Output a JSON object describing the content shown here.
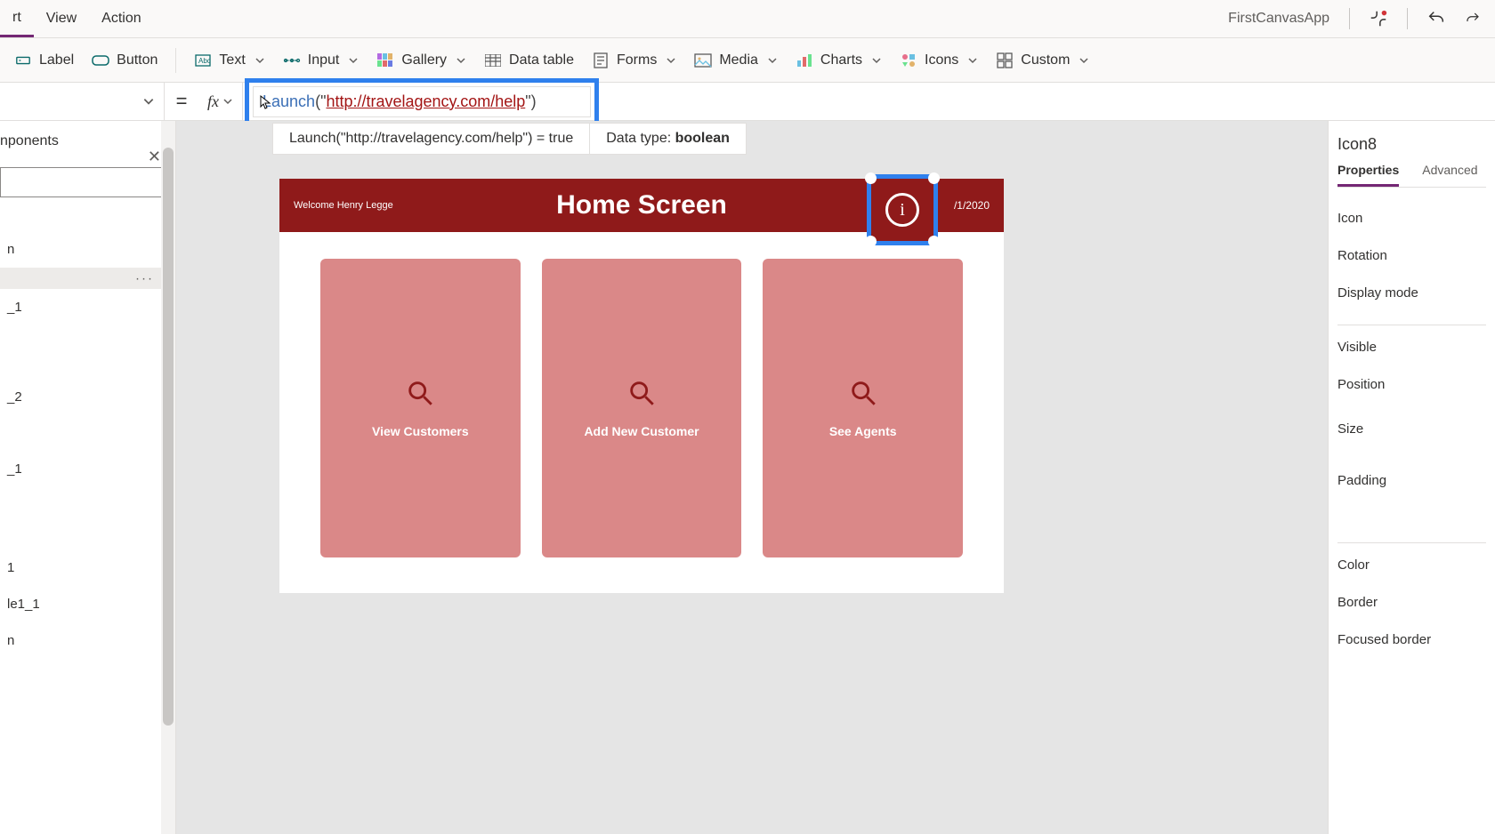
{
  "menu": {
    "items": [
      "rt",
      "View",
      "Action"
    ],
    "app_name": "FirstCanvasApp"
  },
  "ribbon": {
    "label": "Label",
    "button": "Button",
    "text": "Text",
    "input": "Input",
    "gallery": "Gallery",
    "data_table": "Data table",
    "forms": "Forms",
    "media": "Media",
    "charts": "Charts",
    "icons": "Icons",
    "custom": "Custom"
  },
  "formula": {
    "equals": "=",
    "fx": "fx",
    "func": "Launch",
    "open": "(",
    "quote1": "\"",
    "url": "http://travelagency.com/help",
    "quote2": "\"",
    "close": ")",
    "hint_expr": "Launch(\"http://travelagency.com/help\")  =  true",
    "hint_type_label": "Data type: ",
    "hint_type_value": "boolean"
  },
  "tree": {
    "tab": "nponents",
    "items": [
      "n",
      "",
      "_1",
      "_2",
      "_1",
      "1",
      "le1_1",
      "n"
    ]
  },
  "canvas": {
    "welcome": "Welcome Henry Legge",
    "title": "Home Screen",
    "date": "/1/2020",
    "info_glyph": "i",
    "cards": [
      "View Customers",
      "Add New Customer",
      "See Agents"
    ]
  },
  "props": {
    "selected": "Icon8",
    "tabs": [
      "Properties",
      "Advanced"
    ],
    "rows_a": [
      "Icon",
      "Rotation",
      "Display mode"
    ],
    "rows_b": [
      "Visible",
      "Position",
      "Size",
      "Padding"
    ],
    "rows_c": [
      "Color",
      "Border",
      "Focused border"
    ]
  },
  "colors": {
    "brand_red": "#8f1a1a",
    "card_red": "#da8888",
    "highlight": "#2f80ed",
    "purple": "#742774"
  }
}
